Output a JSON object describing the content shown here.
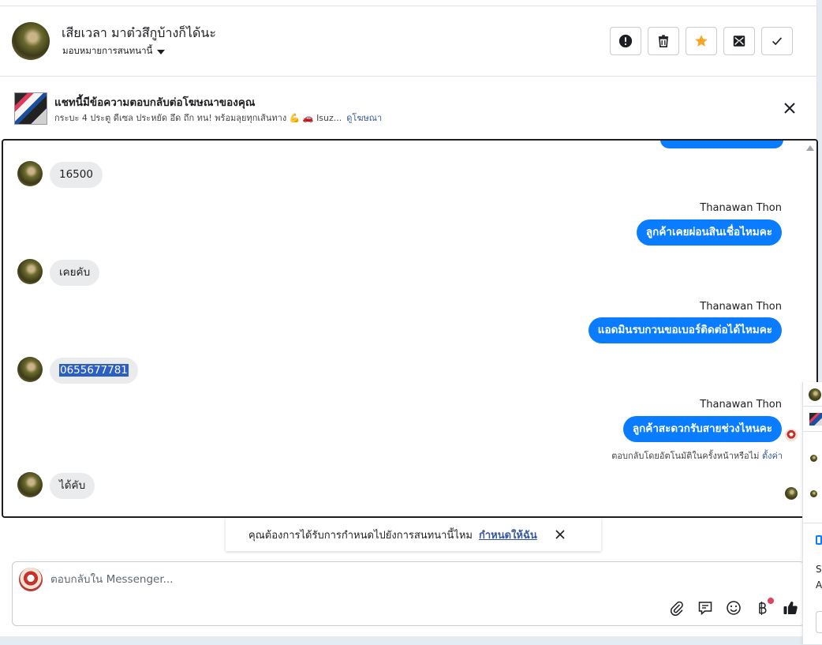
{
  "header": {
    "contact_name": "เสียเวลา มาต๋วสึกูบ้างก็ได้นะ",
    "assign_label": "มอบหมายการสนทนานี้",
    "buttons": [
      {
        "name": "report-button",
        "icon": "exclamation-circle-icon"
      },
      {
        "name": "delete-button",
        "icon": "trash-icon"
      },
      {
        "name": "star-button",
        "icon": "star-icon",
        "color": "#f5a623"
      },
      {
        "name": "mark-unread-button",
        "icon": "envelope-icon"
      },
      {
        "name": "mark-done-button",
        "icon": "checkmark-icon"
      }
    ]
  },
  "ad_banner": {
    "title": "แชทนี้มีข้อความตอบกลับต่อโฆษณาของคุณ",
    "description": "กระบะ 4 ประตู ดีเซล ประหยัด อึด ถึก ทน! พร้อมลุยทุกเส้นทาง 💪 🚗 Isuz...",
    "link": "ดูโฆษณา"
  },
  "messages": [
    {
      "direction": "in",
      "text": "16500"
    },
    {
      "direction": "out",
      "sender": "Thanawan Thon",
      "text": "ลูกค้าเคยผ่อนสินเชื่อไหมคะ"
    },
    {
      "direction": "in",
      "text": "เคยคับ"
    },
    {
      "direction": "out",
      "sender": "Thanawan Thon",
      "text": "แอดมินรบกวนขอเบอร์ติดต่อได้ไหมคะ"
    },
    {
      "direction": "in",
      "text": "0655677781",
      "selected": true
    },
    {
      "direction": "out",
      "sender": "Thanawan Thon",
      "text": "ลูกค้าสะดวกรับสายช่วงไหนคะ"
    },
    {
      "direction": "in",
      "text": "ได้คับ"
    }
  ],
  "auto_reply_note": {
    "text": "ตอบกลับโดยอัตโนมัติในครั้งหน้าหรือไม่",
    "link": "ตั้งค่า"
  },
  "assign_toast": {
    "text": "คุณต้องการได้รับการกำหนดไปยังการสนทนานี้ไหม",
    "link": "กำหนดให้ฉัน"
  },
  "composer": {
    "placeholder": "ตอบกลับใน Messenger...",
    "value": "",
    "tools": [
      "paperclip-icon",
      "saved-reply-icon",
      "emoji-icon",
      "baht-icon",
      "thumbs-up-icon"
    ]
  },
  "colors": {
    "accent": "#0a7cff",
    "link": "#385898",
    "star": "#f5a623",
    "notification_dot": "#e0405a"
  },
  "side_panel": {
    "text_lines": [
      "Sc",
      "A"
    ]
  }
}
